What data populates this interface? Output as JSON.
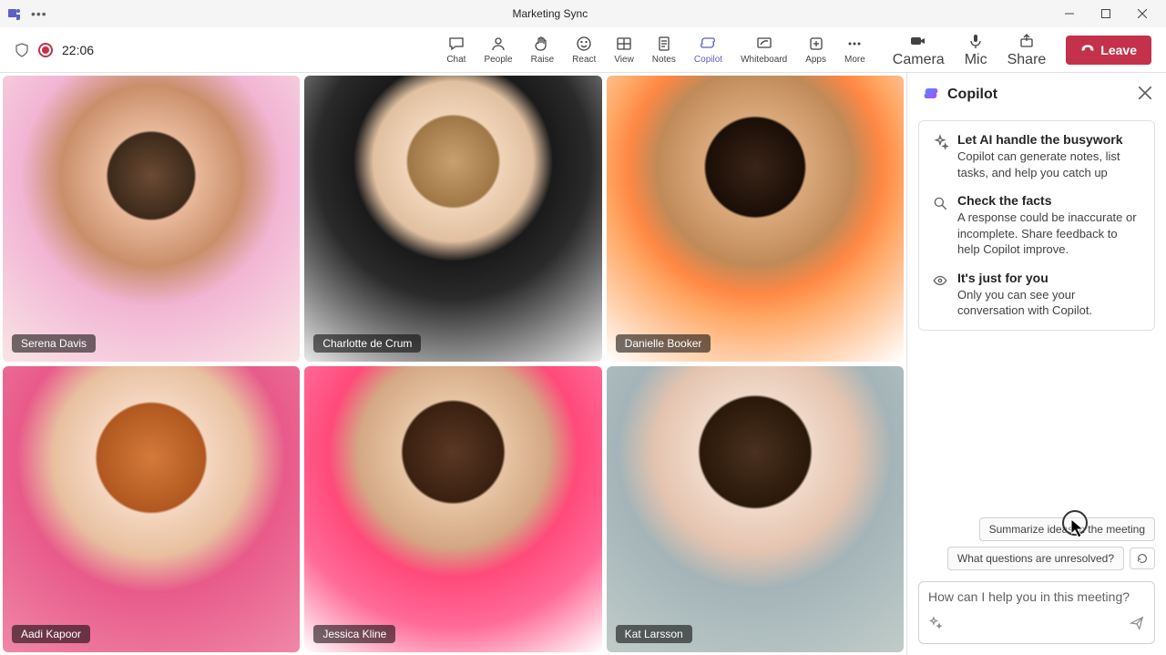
{
  "window": {
    "title": "Marketing Sync"
  },
  "meeting": {
    "timer": "22:06"
  },
  "toolbar": {
    "chat": "Chat",
    "people": "People",
    "raise": "Raise",
    "react": "React",
    "view": "View",
    "notes": "Notes",
    "copilot": "Copilot",
    "whiteboard": "Whiteboard",
    "apps": "Apps",
    "more": "More",
    "camera": "Camera",
    "mic": "Mic",
    "share": "Share",
    "leave": "Leave"
  },
  "participants": [
    {
      "name": "Serena Davis"
    },
    {
      "name": "Charlotte de Crum"
    },
    {
      "name": "Danielle Booker"
    },
    {
      "name": "Aadi Kapoor"
    },
    {
      "name": "Jessica Kline"
    },
    {
      "name": "Kat Larsson"
    }
  ],
  "copilot": {
    "title": "Copilot",
    "info": [
      {
        "title": "Let AI handle the busywork",
        "desc": "Copilot can generate notes, list tasks, and help you catch up"
      },
      {
        "title": "Check the facts",
        "desc": "A response could be inaccurate or incomplete. Share feedback to help Copilot improve."
      },
      {
        "title": "It's just for you",
        "desc": "Only you can see your conversation with Copilot."
      }
    ],
    "suggestions": [
      "Summarize ideas in the meeting",
      "What questions are unresolved?"
    ],
    "input_placeholder": "How can I help you in this meeting?"
  }
}
